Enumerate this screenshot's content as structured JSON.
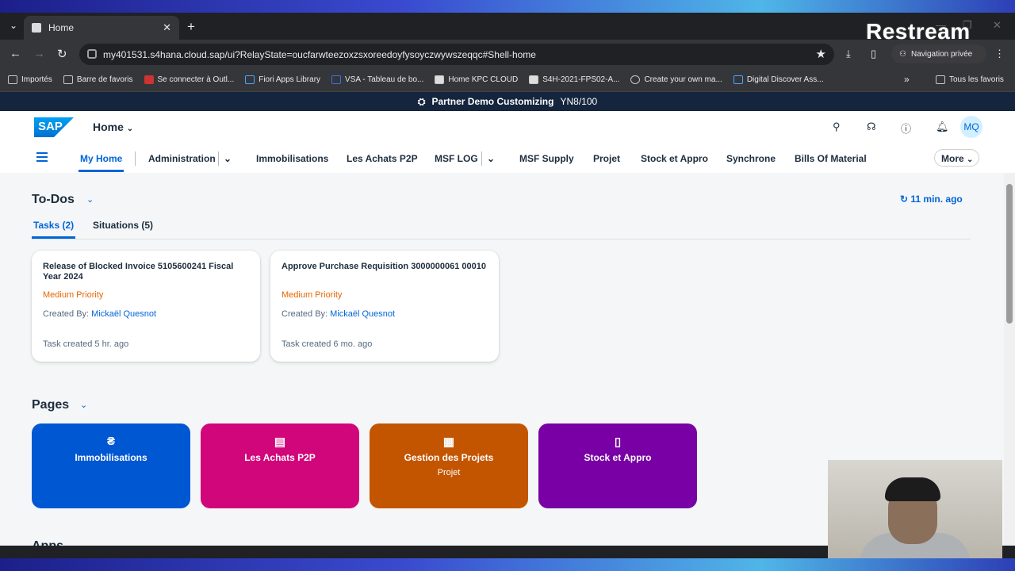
{
  "browser": {
    "tab_title": "Home",
    "url": "my401531.s4hana.cloud.sap/ui?RelayState=oucfarwteezoxzsxoreedoyfysoyczwywszeqqc#Shell-home",
    "incognito_label": "Navigation privée",
    "overlay_brand": "Restream",
    "bookmarks": [
      "Importés",
      "Barre de favoris",
      "Se connecter à Outl...",
      "Fiori Apps Library",
      "VSA - Tableau de bo...",
      "Home KPC CLOUD",
      "S4H-2021-FPS02-A...",
      "Create your own ma...",
      "Digital Discover Ass..."
    ],
    "all_bookmarks": "Tous les favoris"
  },
  "sap": {
    "banner_system": "Partner Demo Customizing",
    "banner_client": "YN8/100",
    "logo": "SAP",
    "shell_title": "Home",
    "avatar_initials": "MQ",
    "nav": {
      "items": [
        "My Home",
        "Administration",
        "Immobilisations",
        "Les Achats P2P",
        "MSF LOG",
        "MSF Supply",
        "Projet",
        "Stock et Appro",
        "Synchrone",
        "Bills Of Material"
      ],
      "more": "More"
    },
    "todos": {
      "title": "To-Dos",
      "refresh": "11 min. ago",
      "tabs": [
        "Tasks (2)",
        "Situations (5)"
      ],
      "cards": [
        {
          "title": "Release of Blocked Invoice 5105600241 Fiscal Year 2024",
          "priority": "Medium Priority",
          "created_by_label": "Created By:",
          "created_by": "Mickaël Quesnot",
          "created": "Task created 5 hr. ago"
        },
        {
          "title": "Approve Purchase Requisition 3000000061 00010",
          "priority": "Medium Priority",
          "created_by_label": "Created By:",
          "created_by": "Mickaël Quesnot",
          "created": "Task created 6 mo. ago"
        }
      ]
    },
    "pages": {
      "title": "Pages",
      "tiles": [
        {
          "label": "Immobilisations",
          "sub": "",
          "color": "#0057d2"
        },
        {
          "label": "Les Achats P2P",
          "sub": "",
          "color": "#d1067b"
        },
        {
          "label": "Gestion des Projets",
          "sub": "Projet",
          "color": "#c35500"
        },
        {
          "label": "Stock et Appro",
          "sub": "",
          "color": "#7800a4"
        }
      ]
    },
    "apps": {
      "title": "Apps"
    }
  }
}
